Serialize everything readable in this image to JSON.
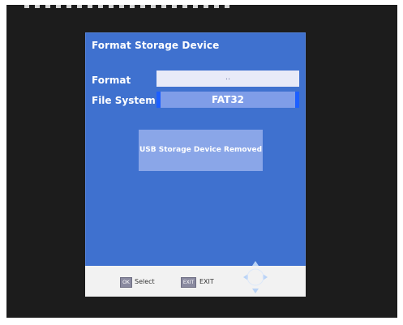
{
  "dialog": {
    "title": "Format Storage Device"
  },
  "rows": {
    "format_label": "Format",
    "format_value": "..",
    "file_system_label": "File System",
    "file_system_value": "FAT32"
  },
  "message": "USB Storage Device Removed",
  "footer": {
    "ok_key": "OK",
    "select_label": "Select",
    "exit_key": "EXIT",
    "exit_label": "EXIT"
  },
  "icons": {
    "nav": "direction-pad-icon",
    "left_arrow": "arrow-left-icon",
    "right_arrow": "arrow-right-icon"
  },
  "colors": {
    "dialog_bg": "#3f71cf",
    "screen_bg": "#1c1c1c",
    "field_selected": "#7f9de8",
    "message_bg": "#8aa6e8",
    "footer_bg": "#f2f2f2"
  }
}
